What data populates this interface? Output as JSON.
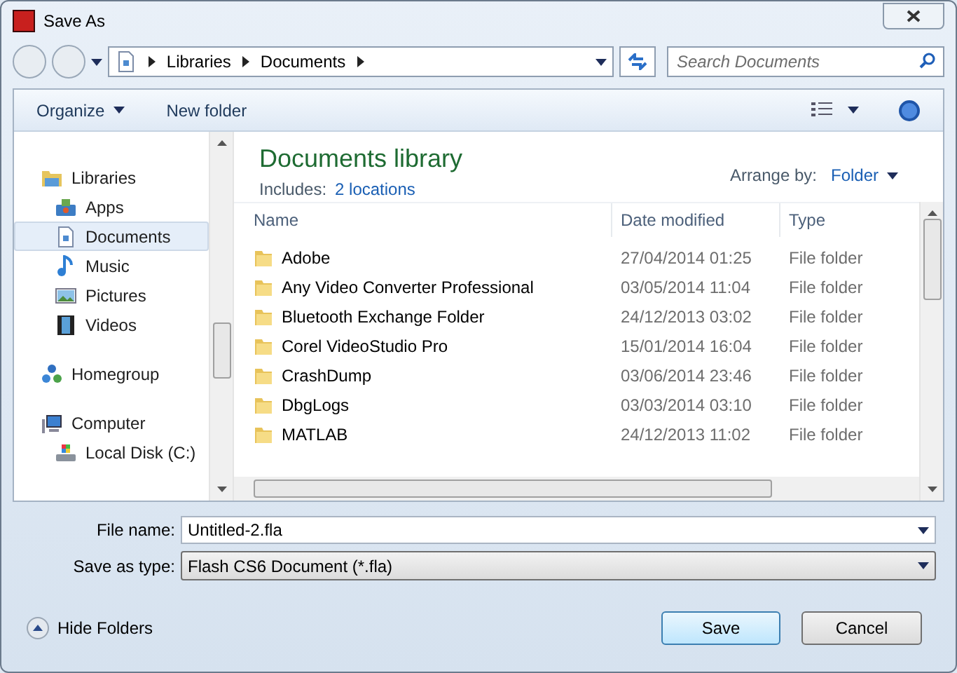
{
  "window": {
    "title": "Save As"
  },
  "address": {
    "crumbs": [
      "Libraries",
      "Documents"
    ]
  },
  "search": {
    "placeholder": "Search Documents"
  },
  "toolbar": {
    "organize": "Organize",
    "new_folder": "New folder"
  },
  "sidebar": {
    "items": [
      {
        "label": "Libraries",
        "kind": "library",
        "selected": false,
        "children": [
          {
            "label": "Apps",
            "kind": "apps",
            "selected": false
          },
          {
            "label": "Documents",
            "kind": "document",
            "selected": true
          },
          {
            "label": "Music",
            "kind": "music",
            "selected": false
          },
          {
            "label": "Pictures",
            "kind": "pictures",
            "selected": false
          },
          {
            "label": "Videos",
            "kind": "videos",
            "selected": false
          }
        ]
      },
      {
        "label": "Homegroup",
        "kind": "homegroup",
        "selected": false
      },
      {
        "label": "Computer",
        "kind": "computer",
        "selected": false,
        "children": [
          {
            "label": "Local Disk (C:)",
            "kind": "disk",
            "selected": false
          }
        ]
      }
    ]
  },
  "library": {
    "title": "Documents library",
    "includes_label": "Includes:",
    "includes_link": "2 locations",
    "arrange_label": "Arrange by:",
    "arrange_value": "Folder"
  },
  "table": {
    "columns": [
      "Name",
      "Date modified",
      "Type"
    ],
    "rows": [
      {
        "name": "Adobe",
        "date": "27/04/2014 01:25",
        "type": "File folder"
      },
      {
        "name": "Any Video Converter Professional",
        "date": "03/05/2014 11:04",
        "type": "File folder"
      },
      {
        "name": "Bluetooth Exchange Folder",
        "date": "24/12/2013 03:02",
        "type": "File folder"
      },
      {
        "name": "Corel VideoStudio Pro",
        "date": "15/01/2014 16:04",
        "type": "File folder"
      },
      {
        "name": "CrashDump",
        "date": "03/06/2014 23:46",
        "type": "File folder"
      },
      {
        "name": "DbgLogs",
        "date": "03/03/2014 03:10",
        "type": "File folder"
      },
      {
        "name": "MATLAB",
        "date": "24/12/2013 11:02",
        "type": "File folder"
      }
    ]
  },
  "form": {
    "file_name_label": "File name:",
    "file_name": "Untitled-2.fla",
    "type_label": "Save as type:",
    "type_value": "Flash CS6 Document (*.fla)"
  },
  "footer": {
    "hide_folders": "Hide Folders",
    "save": "Save",
    "cancel": "Cancel"
  }
}
